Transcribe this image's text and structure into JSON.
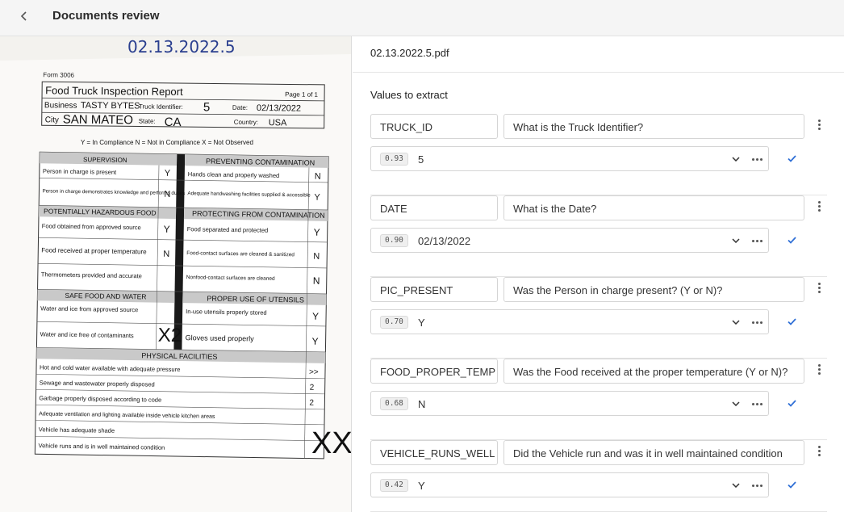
{
  "header": {
    "title": "Documents review",
    "back_icon": "chevron-left-icon"
  },
  "document": {
    "handwritten_name": "02.13.2022.5",
    "form_no": "Form 3006",
    "title": "Food Truck Inspection Report",
    "page": "Page 1 of 1",
    "business_label": "Business",
    "business_value": "TASTY BYTES",
    "truck_label": "Truck Identifier:",
    "truck_value": "5",
    "date_label": "Date:",
    "date_value": "02/13/2022",
    "city_label": "City",
    "city_value": "SAN MATEO",
    "state_label": "State:",
    "state_value": "CA",
    "country_label": "Country:",
    "country_value": "USA",
    "legend": "Y = In Compliance   N = Not in Compliance   X = Not Observed",
    "sec_supervision": "SUPERVISION",
    "sec_prevent": "PREVENTING CONTAMINATION",
    "sec_phf": "POTENTIALLY HAZARDOUS FOOD",
    "sec_protect": "PROTECTING FROM CONTAMINATION",
    "sec_safe": "SAFE FOOD AND WATER",
    "sec_utensils": "PROPER USE OF UTENSILS",
    "sec_physical": "PHYSICAL FACILITIES",
    "left_rows": [
      {
        "text": "Person in charge is present",
        "mark": "Y"
      },
      {
        "text": "Person in charge demonstrates knowledge and performs duties",
        "mark": "N"
      },
      {
        "text": "Food obtained from approved source",
        "mark": "Y"
      },
      {
        "text": "Food received at proper temperature",
        "mark": "N"
      },
      {
        "text": "Thermometers provided and accurate",
        "mark": ""
      },
      {
        "text": "Water and ice from approved source",
        "mark": ""
      },
      {
        "text": "Water and ice free of contaminants",
        "mark": "X2"
      }
    ],
    "right_rows": [
      {
        "text": "Hands clean and properly washed",
        "mark": "N"
      },
      {
        "text": "Adequate handwashing facilities supplied & accessible",
        "mark": "Y"
      },
      {
        "text": "Food separated and protected",
        "mark": "Y"
      },
      {
        "text": "Food-contact surfaces are cleaned & sanitized",
        "mark": "N"
      },
      {
        "text": "Nonfood-contact surfaces are cleaned",
        "mark": "N"
      },
      {
        "text": "In-use utensils properly stored",
        "mark": "Y"
      },
      {
        "text": "Gloves used properly",
        "mark": "Y"
      }
    ],
    "facility_rows": [
      {
        "text": "Hot and cold water available with adequate pressure",
        "mark": ">>"
      },
      {
        "text": "Sewage and wastewater properly disposed",
        "mark": "2"
      },
      {
        "text": "Garbage properly disposed according to code",
        "mark": "2"
      },
      {
        "text": "Adequate ventilation and lighting available inside vehicle kitchen areas",
        "mark": ""
      },
      {
        "text": "Vehicle has adequate shade",
        "mark": ""
      },
      {
        "text": "Vehicle runs and is in well maintained condition",
        "mark": ""
      }
    ],
    "big_mark": "XX"
  },
  "panel": {
    "filename": "02.13.2022.5.pdf",
    "section_title": "Values to extract",
    "fields": [
      {
        "key": "TRUCK_ID",
        "question": "What is the Truck Identifier?",
        "confidence": "0.93",
        "answer": "5"
      },
      {
        "key": "DATE",
        "question": "What is the Date?",
        "confidence": "0.90",
        "answer": "02/13/2022"
      },
      {
        "key": "PIC_PRESENT",
        "question": "Was the Person in charge present? (Y or N)?",
        "confidence": "0.70",
        "answer": "Y"
      },
      {
        "key": "FOOD_PROPER_TEMP",
        "question": "Was the Food received at the proper temperature (Y or N)?",
        "confidence": "0.68",
        "answer": "N"
      },
      {
        "key": "VEHICLE_RUNS_WELL",
        "question": "Did the Vehicle run and was it in well maintained condition",
        "confidence": "0.42",
        "answer": "Y"
      }
    ]
  },
  "colors": {
    "accent": "#2f6fd6",
    "topbar": "#f5f5f5"
  }
}
